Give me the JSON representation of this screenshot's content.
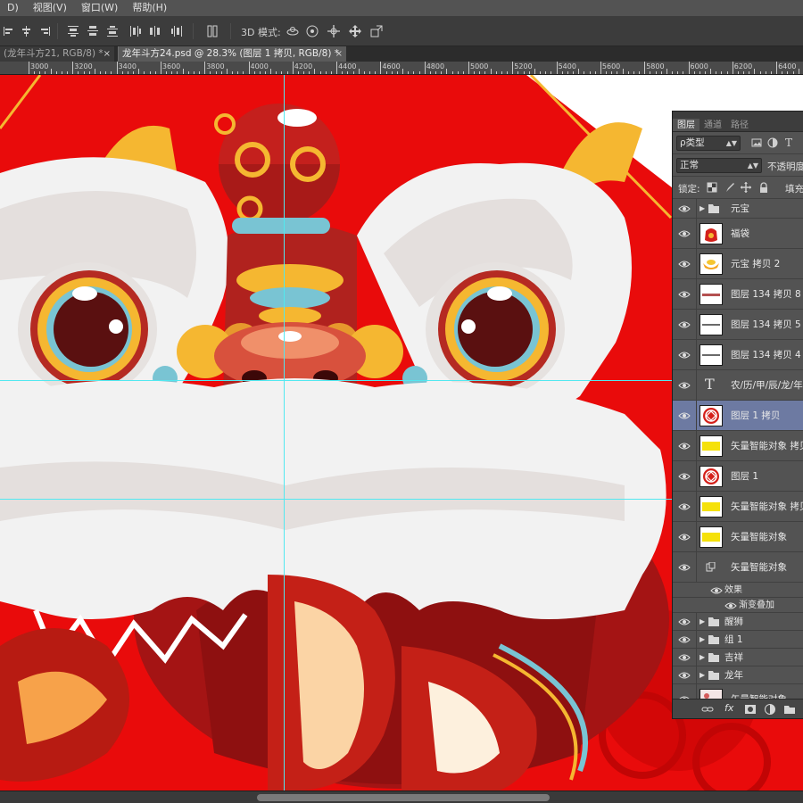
{
  "menubar": {
    "items": [
      "D)",
      "视图(V)",
      "窗口(W)",
      "帮助(H)"
    ]
  },
  "options": {
    "mode_3d_label": "3D 模式:"
  },
  "tabs": {
    "inactive_title": "(龙年斗方21, RGB/8) *",
    "active_title": "龙年斗方24.psd @ 28.3% (图层 1 拷贝, RGB/8) *",
    "close": "×"
  },
  "ruler": {
    "labels": [
      "3000",
      "3200",
      "3400",
      "3600",
      "3800",
      "4000",
      "4200",
      "4400",
      "4600",
      "4800",
      "5000",
      "5200",
      "5400",
      "5600",
      "5800",
      "6000",
      "6200",
      "6400"
    ]
  },
  "colors": {
    "background_red": "#e90b0b",
    "mane_white": "#f2f2f2",
    "mane_shadow": "#c9c4c2",
    "gold": "#f5b731",
    "dark_red": "#7a1717",
    "teal": "#79c4d3",
    "guide": "#52e8f0",
    "selection": "#6d7aa2"
  },
  "layers_panel": {
    "tabs": [
      "图层",
      "通道",
      "路径"
    ],
    "filter_label": "ρ类型",
    "blend_mode": "正常",
    "opacity_label": "不透明度",
    "lock_label": "锁定:",
    "fill_label": "填充",
    "layers": [
      {
        "name": "元宝",
        "kind": "group"
      },
      {
        "name": "福袋",
        "kind": "image"
      },
      {
        "name": "元宝 拷贝 2",
        "kind": "image"
      },
      {
        "name": "图层 134 拷贝 8",
        "kind": "image"
      },
      {
        "name": "图层 134 拷贝 5",
        "kind": "image"
      },
      {
        "name": "图层 134 拷贝 4",
        "kind": "image"
      },
      {
        "name": "农/历/甲/辰/龙/年",
        "kind": "text"
      },
      {
        "name": "图层 1 拷贝",
        "kind": "image",
        "selected": true
      },
      {
        "name": "矢量智能对象 拷贝",
        "kind": "smart"
      },
      {
        "name": "图层 1",
        "kind": "image"
      },
      {
        "name": "矢量智能对象 拷贝",
        "kind": "smart"
      },
      {
        "name": "矢量智能对象",
        "kind": "smart"
      },
      {
        "name": "矢量智能对象",
        "kind": "smart-fx"
      },
      {
        "name": "效果",
        "kind": "effect-head"
      },
      {
        "name": "渐变叠加",
        "kind": "effect"
      },
      {
        "name": "醒狮",
        "kind": "group"
      },
      {
        "name": "组 1",
        "kind": "group"
      },
      {
        "name": "吉祥",
        "kind": "group"
      },
      {
        "name": "龙年",
        "kind": "group"
      },
      {
        "name": "矢量智能对象",
        "kind": "image"
      }
    ],
    "footer_fx": "fx"
  }
}
